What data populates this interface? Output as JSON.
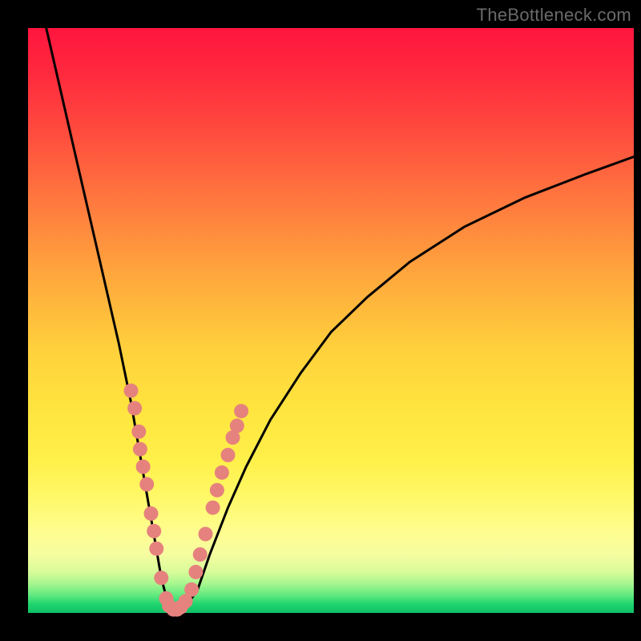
{
  "watermark": "TheBottleneck.com",
  "colors": {
    "curve_stroke": "#000000",
    "dot_fill": "#e6827e",
    "dot_stroke": "#c96660"
  },
  "chart_data": {
    "type": "line",
    "title": "",
    "xlabel": "",
    "ylabel": "",
    "xlim": [
      0,
      100
    ],
    "ylim": [
      0,
      100
    ],
    "series": [
      {
        "name": "bottleneck-curve",
        "x": [
          3,
          5,
          7,
          9,
          11,
          13,
          15,
          17,
          19,
          20,
          21,
          22,
          23,
          24,
          25,
          26,
          28,
          30,
          33,
          36,
          40,
          45,
          50,
          56,
          63,
          72,
          82,
          92,
          100
        ],
        "y": [
          100,
          91,
          82,
          73,
          64,
          55,
          46,
          36,
          24,
          18,
          12,
          6,
          2,
          0.5,
          0.5,
          1,
          4,
          10,
          18,
          25,
          33,
          41,
          48,
          54,
          60,
          66,
          71,
          75,
          78
        ]
      }
    ],
    "markers": {
      "name": "highlight-dots",
      "points": [
        {
          "x": 17.0,
          "y": 38
        },
        {
          "x": 17.6,
          "y": 35
        },
        {
          "x": 18.3,
          "y": 31
        },
        {
          "x": 18.5,
          "y": 28
        },
        {
          "x": 19.0,
          "y": 25
        },
        {
          "x": 19.6,
          "y": 22
        },
        {
          "x": 20.3,
          "y": 17
        },
        {
          "x": 20.8,
          "y": 14
        },
        {
          "x": 21.2,
          "y": 11
        },
        {
          "x": 22.0,
          "y": 6
        },
        {
          "x": 22.8,
          "y": 2.5
        },
        {
          "x": 23.3,
          "y": 1.2
        },
        {
          "x": 24.0,
          "y": 0.6
        },
        {
          "x": 24.6,
          "y": 0.6
        },
        {
          "x": 25.2,
          "y": 1.0
        },
        {
          "x": 26.0,
          "y": 2.0
        },
        {
          "x": 27.0,
          "y": 4.0
        },
        {
          "x": 27.7,
          "y": 7.0
        },
        {
          "x": 28.4,
          "y": 10.0
        },
        {
          "x": 29.3,
          "y": 13.5
        },
        {
          "x": 30.5,
          "y": 18.0
        },
        {
          "x": 31.2,
          "y": 21.0
        },
        {
          "x": 32.0,
          "y": 24.0
        },
        {
          "x": 33.0,
          "y": 27.0
        },
        {
          "x": 33.8,
          "y": 30.0
        },
        {
          "x": 34.5,
          "y": 32.0
        },
        {
          "x": 35.2,
          "y": 34.5
        }
      ]
    }
  }
}
